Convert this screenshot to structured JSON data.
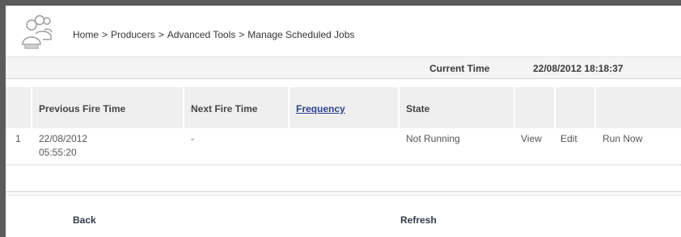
{
  "breadcrumb": {
    "items": [
      "Home",
      "Producers",
      "Advanced Tools",
      "Manage Scheduled Jobs"
    ],
    "separator": ">"
  },
  "status": {
    "current_time_label": "Current Time",
    "current_time_value": "22/08/2012 18:18:37"
  },
  "table": {
    "headers": {
      "previous_fire_time": "Previous Fire Time",
      "next_fire_time": "Next Fire Time",
      "frequency": "Frequency",
      "state": "State"
    },
    "rows": [
      {
        "index": "1",
        "previous_fire_time_date": "22/08/2012",
        "previous_fire_time_time": "05:55:20",
        "next_fire_time": "-",
        "frequency": "",
        "state": "Not Running",
        "actions": {
          "view": "View",
          "edit": "Edit",
          "run_now": "Run Now"
        }
      }
    ]
  },
  "footer": {
    "back_label": "Back",
    "refresh_label": "Refresh"
  },
  "icons": {
    "header_icon": "users-group-icon"
  },
  "colors": {
    "frame_border": "#5b5b5b",
    "header_cell_bg": "#efefef",
    "link": "#2a3f8f"
  }
}
